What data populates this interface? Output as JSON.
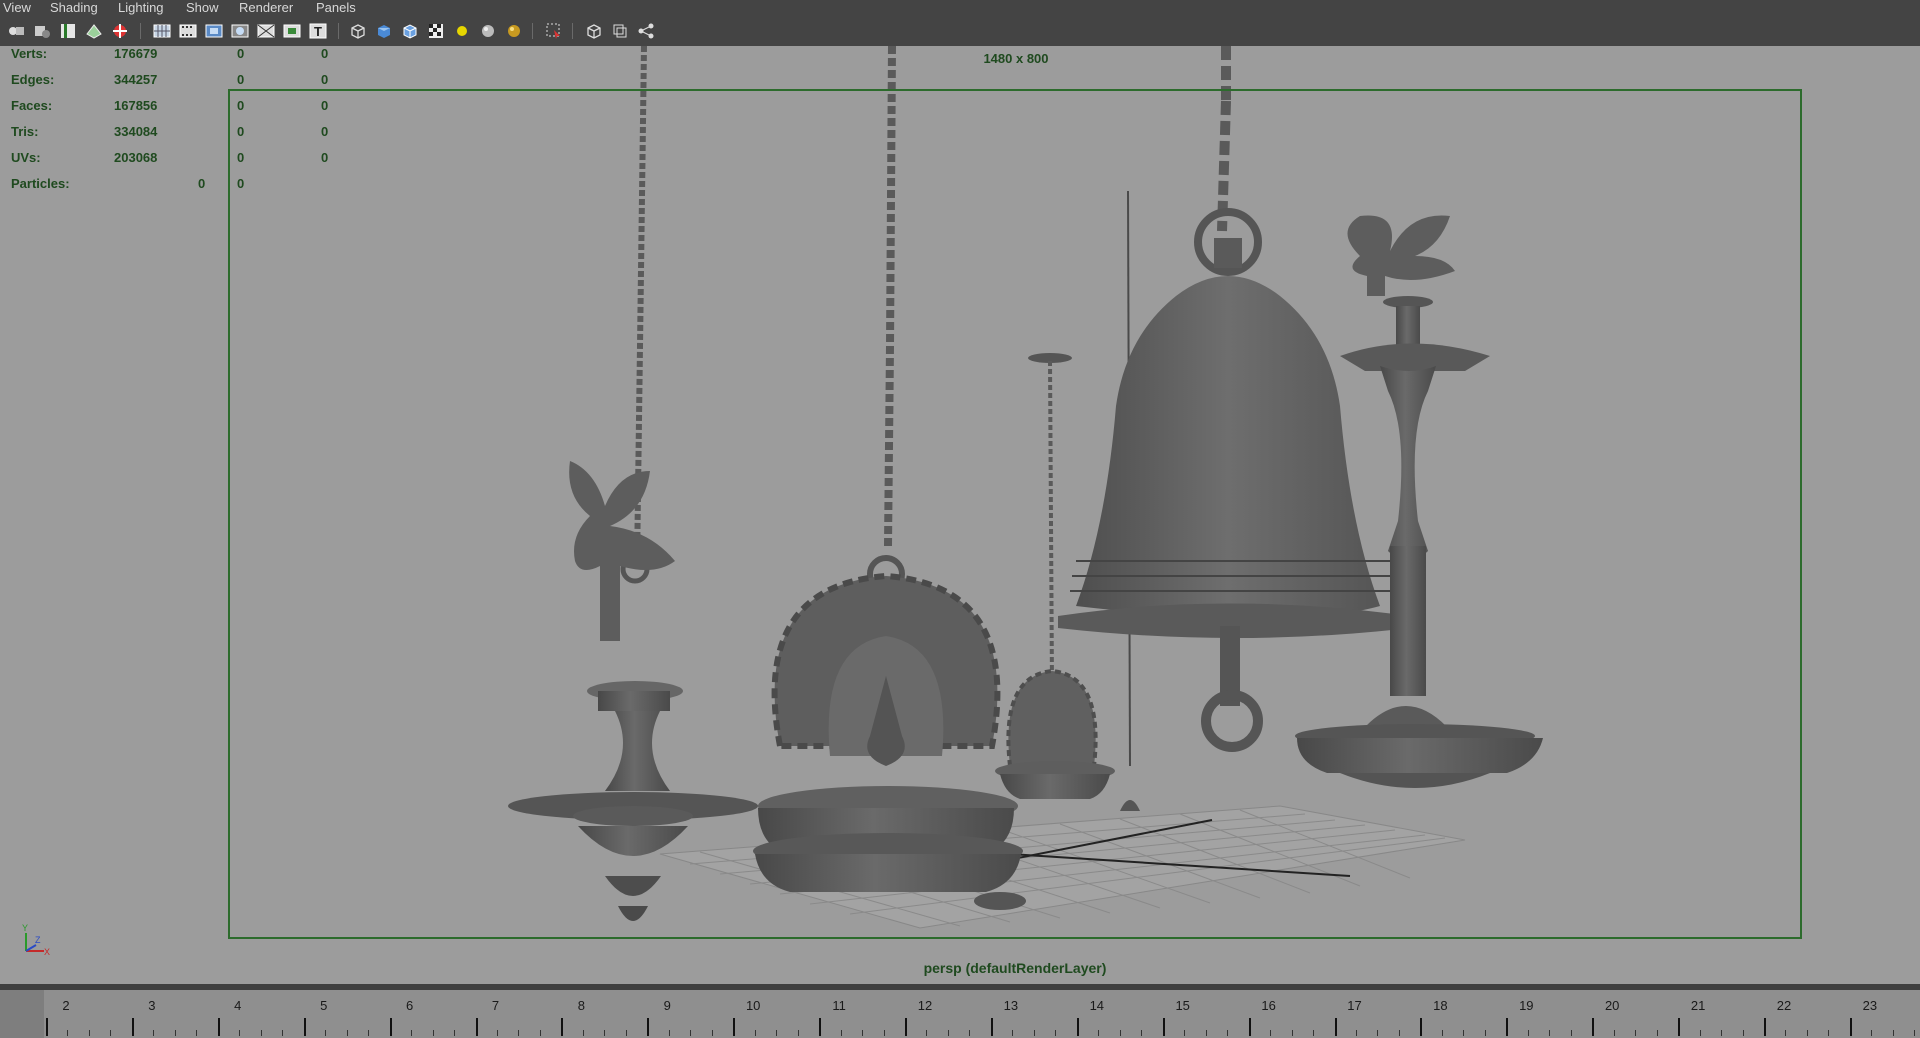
{
  "menubar": {
    "items": [
      "View",
      "Shading",
      "Lighting",
      "Show",
      "Renderer",
      "Panels"
    ]
  },
  "toolbar": {
    "icons": [
      "select-camera-icon",
      "camera-attributes-icon",
      "bookmarks-icon",
      "image-plane-icon",
      "2d-pan-zoom-icon",
      "grid-icon",
      "film-gate-icon",
      "resolution-gate-icon",
      "gate-mask-icon",
      "field-chart-icon",
      "safe-title-icon",
      "wireframe-icon",
      "smooth-shade-icon",
      "wireframe-on-shaded-icon",
      "textured-icon",
      "use-all-lights-icon",
      "shadows-icon",
      "screen-space-ambient-occlusion-icon",
      "isolate-select-icon",
      "xray-icon",
      "xray-active-components-icon",
      "xray-joints-icon"
    ]
  },
  "hud": {
    "stats": [
      {
        "label": "Verts:",
        "values": [
          "176679",
          "0",
          "0"
        ]
      },
      {
        "label": "Edges:",
        "values": [
          "344257",
          "0",
          "0"
        ]
      },
      {
        "label": "Faces:",
        "values": [
          "167856",
          "0",
          "0"
        ]
      },
      {
        "label": "Tris:",
        "values": [
          "334084",
          "0",
          "0"
        ]
      },
      {
        "label": "UVs:",
        "values": [
          "203068",
          "0",
          "0"
        ]
      },
      {
        "label": "Particles:",
        "values": [
          "0",
          "0"
        ]
      }
    ],
    "resolution": "1480 x 800",
    "camera": "persp (defaultRenderLayer)"
  },
  "axis": {
    "y": "Y",
    "x": "X",
    "z": "Z"
  },
  "timeslider": {
    "ticks": [
      "2",
      "3",
      "4",
      "5",
      "6",
      "7",
      "8",
      "9",
      "10",
      "11",
      "12",
      "13",
      "14",
      "15",
      "16",
      "17",
      "18",
      "19",
      "20",
      "21",
      "22",
      "23"
    ]
  },
  "colors": {
    "menubar_bg": "#444444",
    "viewport_bg": "#9c9c9c",
    "hud_text": "#1f4a1f",
    "resolution_gate": "#2c6b2c",
    "model_gray": "#5c5c5c"
  }
}
